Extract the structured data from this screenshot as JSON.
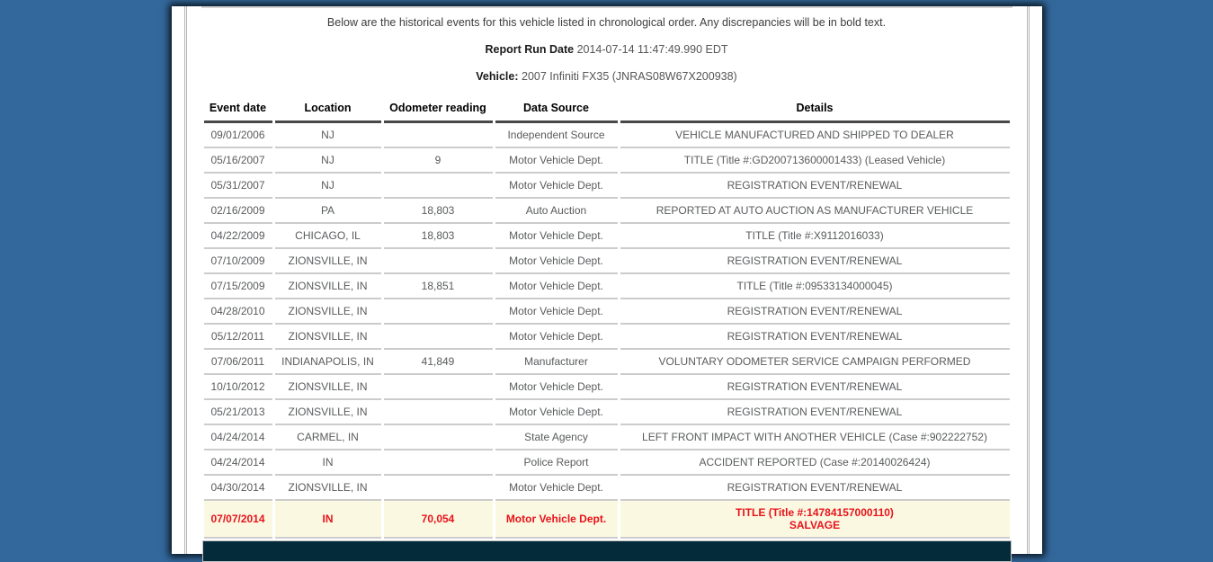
{
  "colors": {
    "page_background": "#33689C",
    "panel_background": "#FFFFFF",
    "row_text": "#595B5D",
    "header_text": "#000000",
    "discrepancy_text": "#E8131B",
    "discrepancy_row_background": "#FBF8E1",
    "section_bar_background": "#032B3A"
  },
  "header": {
    "intro": "Below are the historical events for this vehicle listed in chronological order. Any discrepancies will be in bold text.",
    "report_run_date_label": "Report Run Date",
    "report_run_date_value": "2014-07-14 11:47:49.990 EDT",
    "vehicle_label": "Vehicle:",
    "vehicle_value": "2007 Infiniti FX35 (JNRAS08W67X200938)"
  },
  "table": {
    "columns": [
      "Event date",
      "Location",
      "Odometer reading",
      "Data Source",
      "Details"
    ],
    "rows": [
      {
        "event_date": "09/01/2006",
        "location": "NJ",
        "odometer": "",
        "data_source": "Independent Source",
        "details": [
          "VEHICLE MANUFACTURED AND SHIPPED TO DEALER"
        ],
        "discrepancy": false
      },
      {
        "event_date": "05/16/2007",
        "location": "NJ",
        "odometer": "9",
        "data_source": "Motor Vehicle Dept.",
        "details": [
          "TITLE (Title #:GD200713600001433) (Leased Vehicle)"
        ],
        "discrepancy": false
      },
      {
        "event_date": "05/31/2007",
        "location": "NJ",
        "odometer": "",
        "data_source": "Motor Vehicle Dept.",
        "details": [
          "REGISTRATION EVENT/RENEWAL"
        ],
        "discrepancy": false
      },
      {
        "event_date": "02/16/2009",
        "location": "PA",
        "odometer": "18,803",
        "data_source": "Auto Auction",
        "details": [
          "REPORTED AT AUTO AUCTION AS MANUFACTURER VEHICLE"
        ],
        "discrepancy": false
      },
      {
        "event_date": "04/22/2009",
        "location": "CHICAGO, IL",
        "odometer": "18,803",
        "data_source": "Motor Vehicle Dept.",
        "details": [
          "TITLE (Title #:X9112016033)"
        ],
        "discrepancy": false
      },
      {
        "event_date": "07/10/2009",
        "location": "ZIONSVILLE, IN",
        "odometer": "",
        "data_source": "Motor Vehicle Dept.",
        "details": [
          "REGISTRATION EVENT/RENEWAL"
        ],
        "discrepancy": false
      },
      {
        "event_date": "07/15/2009",
        "location": "ZIONSVILLE, IN",
        "odometer": "18,851",
        "data_source": "Motor Vehicle Dept.",
        "details": [
          "TITLE (Title #:09533134000045)"
        ],
        "discrepancy": false
      },
      {
        "event_date": "04/28/2010",
        "location": "ZIONSVILLE, IN",
        "odometer": "",
        "data_source": "Motor Vehicle Dept.",
        "details": [
          "REGISTRATION EVENT/RENEWAL"
        ],
        "discrepancy": false
      },
      {
        "event_date": "05/12/2011",
        "location": "ZIONSVILLE, IN",
        "odometer": "",
        "data_source": "Motor Vehicle Dept.",
        "details": [
          "REGISTRATION EVENT/RENEWAL"
        ],
        "discrepancy": false
      },
      {
        "event_date": "07/06/2011",
        "location": "INDIANAPOLIS, IN",
        "odometer": "41,849",
        "data_source": "Manufacturer",
        "details": [
          "VOLUNTARY ODOMETER SERVICE CAMPAIGN PERFORMED"
        ],
        "discrepancy": false
      },
      {
        "event_date": "10/10/2012",
        "location": "ZIONSVILLE, IN",
        "odometer": "",
        "data_source": "Motor Vehicle Dept.",
        "details": [
          "REGISTRATION EVENT/RENEWAL"
        ],
        "discrepancy": false
      },
      {
        "event_date": "05/21/2013",
        "location": "ZIONSVILLE, IN",
        "odometer": "",
        "data_source": "Motor Vehicle Dept.",
        "details": [
          "REGISTRATION EVENT/RENEWAL"
        ],
        "discrepancy": false
      },
      {
        "event_date": "04/24/2014",
        "location": "CARMEL, IN",
        "odometer": "",
        "data_source": "State Agency",
        "details": [
          "LEFT FRONT IMPACT WITH ANOTHER VEHICLE (Case #:902222752)"
        ],
        "discrepancy": false
      },
      {
        "event_date": "04/24/2014",
        "location": "IN",
        "odometer": "",
        "data_source": "Police Report",
        "details": [
          "ACCIDENT REPORTED (Case #:20140026424)"
        ],
        "discrepancy": false
      },
      {
        "event_date": "04/30/2014",
        "location": "ZIONSVILLE, IN",
        "odometer": "",
        "data_source": "Motor Vehicle Dept.",
        "details": [
          "REGISTRATION EVENT/RENEWAL"
        ],
        "discrepancy": false
      },
      {
        "event_date": "07/07/2014",
        "location": "IN",
        "odometer": "70,054",
        "data_source": "Motor Vehicle Dept.",
        "details": [
          "TITLE (Title #:14784157000110)",
          "SALVAGE"
        ],
        "discrepancy": true
      }
    ]
  }
}
